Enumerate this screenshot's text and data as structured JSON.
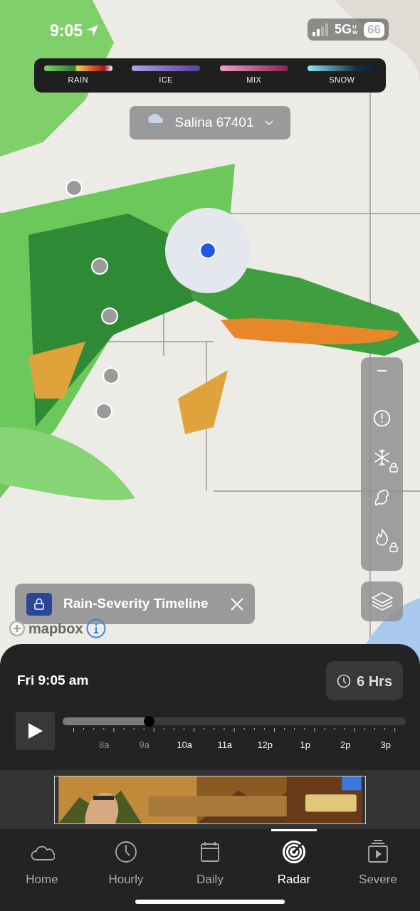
{
  "status_bar": {
    "time": "9:05",
    "network": "5G",
    "network_suffix": "UW",
    "battery": "66"
  },
  "legend": [
    {
      "label": "RAIN",
      "kind": "rain"
    },
    {
      "label": "ICE",
      "kind": "ice"
    },
    {
      "label": "MIX",
      "kind": "mix"
    },
    {
      "label": "SNOW",
      "kind": "snow"
    }
  ],
  "location_selector": {
    "label": "Salina 67401"
  },
  "layer_toolbar": [
    {
      "kind": "collapse",
      "locked": false
    },
    {
      "kind": "alert",
      "locked": false
    },
    {
      "kind": "snow",
      "locked": true
    },
    {
      "kind": "hurricane",
      "locked": false
    },
    {
      "kind": "fire",
      "locked": true
    }
  ],
  "feature_chip": {
    "label": "Rain-Severity Timeline",
    "locked": true
  },
  "attribution": {
    "logo": "mapbox"
  },
  "timeline": {
    "time": "Fri 9:05 am",
    "range_button": "6 Hrs",
    "level": 0.25,
    "ticks": [
      {
        "label": "8a",
        "past": true
      },
      {
        "label": "9a",
        "past": true
      },
      {
        "label": "10a",
        "past": false
      },
      {
        "label": "11a",
        "past": false
      },
      {
        "label": "12p",
        "past": false
      },
      {
        "label": "1p",
        "past": false
      },
      {
        "label": "2p",
        "past": false
      },
      {
        "label": "3p",
        "past": false
      }
    ]
  },
  "tabs": [
    {
      "label": "Home",
      "kind": "home",
      "selected": false
    },
    {
      "label": "Hourly",
      "kind": "hourly",
      "selected": false
    },
    {
      "label": "Daily",
      "kind": "daily",
      "selected": false
    },
    {
      "label": "Radar",
      "kind": "radar",
      "selected": true
    },
    {
      "label": "Severe",
      "kind": "severe",
      "selected": false
    }
  ]
}
